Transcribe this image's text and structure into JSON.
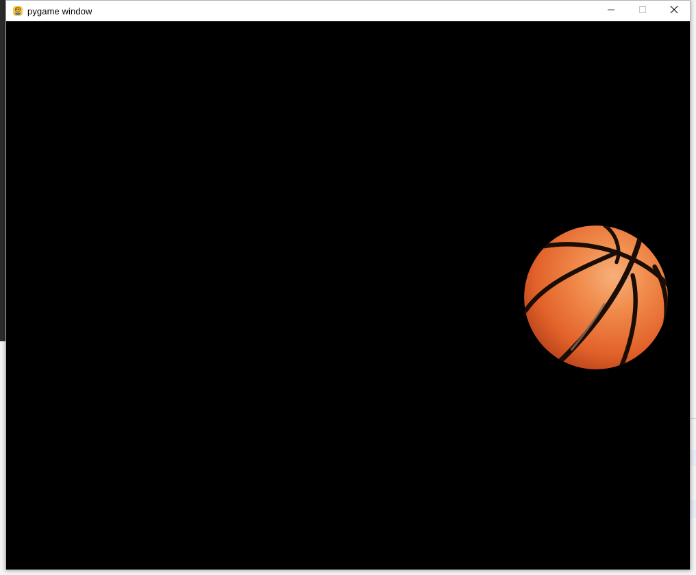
{
  "window": {
    "title": "pygame window",
    "app_icon": "pygame-snake-icon",
    "controls": {
      "minimize_icon": "minimize-icon",
      "maximize_icon": "maximize-icon",
      "close_icon": "close-icon"
    },
    "maximize_enabled": false
  },
  "canvas": {
    "background_color": "#000000",
    "sprites": [
      {
        "name": "basketball",
        "icon": "basketball-sprite",
        "color": "#e8692e"
      }
    ]
  }
}
